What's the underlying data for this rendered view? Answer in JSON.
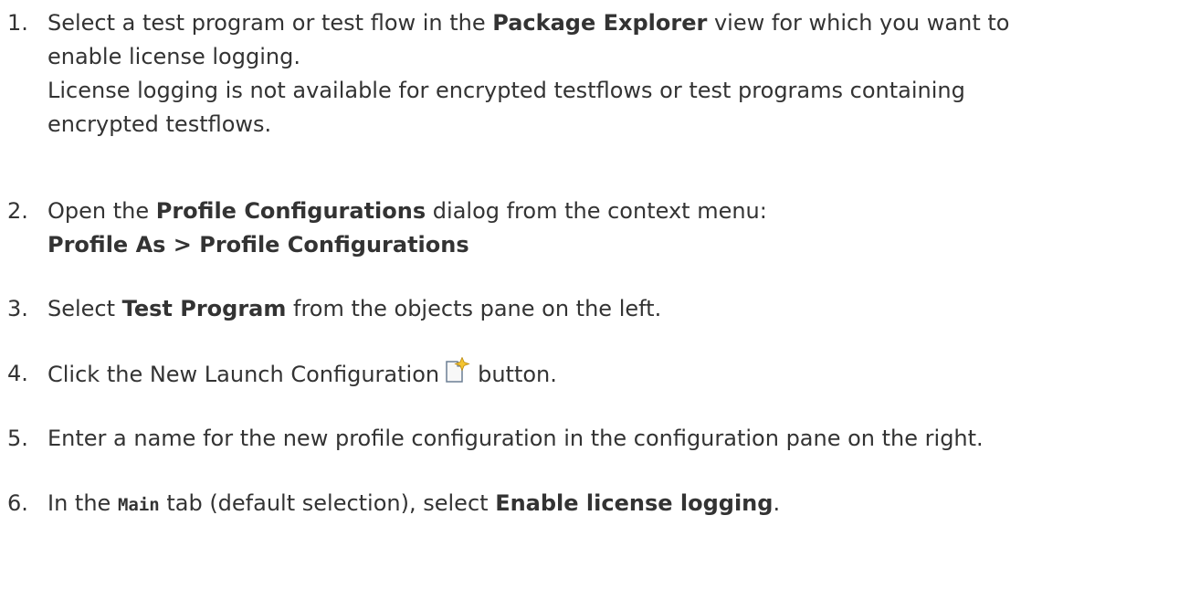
{
  "steps": [
    {
      "number": "1.",
      "p1_before": "Select a test program or test flow in the ",
      "p1_bold": "Package Explorer",
      "p1_after": " view for which you want to",
      "p1_line2": "enable license logging.",
      "p2_line1": "License logging is not available for encrypted testflows or test programs containing",
      "p2_line2": "encrypted testflows."
    },
    {
      "number": "2.",
      "before": "Open the ",
      "bold": "Profile Configurations",
      "after": " dialog from the context menu:",
      "menu_path": "Profile As > Profile Configurations"
    },
    {
      "number": "3.",
      "before": "Select ",
      "bold": "Test Program",
      "after": " from the objects pane on the left."
    },
    {
      "number": "4.",
      "before": "Click the New Launch Configuration",
      "icon": "new-launch-configuration-icon",
      "after": "button."
    },
    {
      "number": "5.",
      "text": "Enter a name for the new profile configuration in the configuration pane on the right."
    },
    {
      "number": "6.",
      "before": "In the ",
      "code": "Main",
      "middle": " tab (default selection), select ",
      "bold": "Enable license logging",
      "after": "."
    }
  ]
}
